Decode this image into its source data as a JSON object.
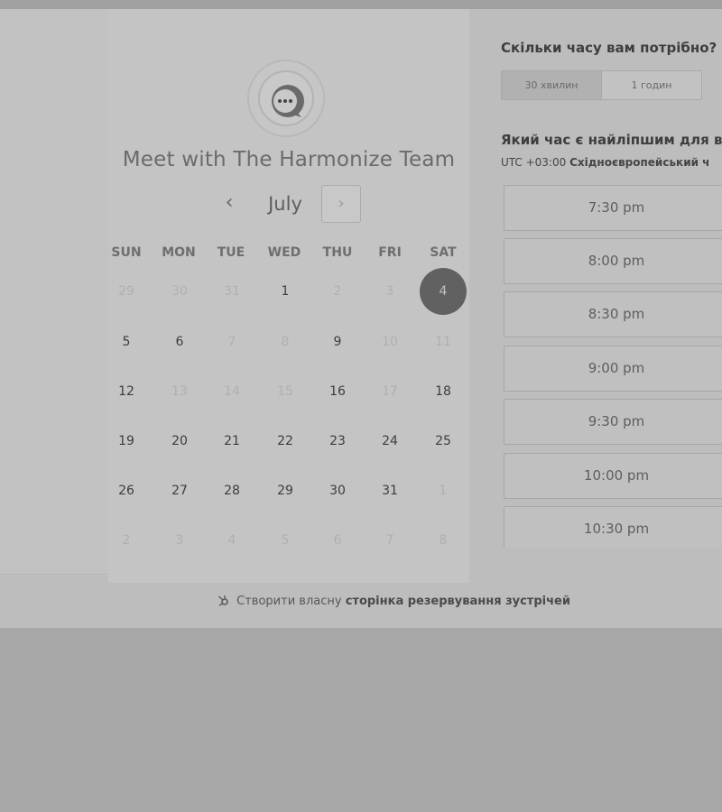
{
  "meeting": {
    "title": "Meet with The Harmonize Team"
  },
  "calendar": {
    "month": "July",
    "prev_glyph": "‹",
    "next_glyph": "›",
    "weekdays": [
      "SUN",
      "MON",
      "TUE",
      "WED",
      "THU",
      "FRI",
      "SAT"
    ],
    "weeks": [
      [
        {
          "d": "29",
          "s": "muted"
        },
        {
          "d": "30",
          "s": "muted"
        },
        {
          "d": "31",
          "s": "muted"
        },
        {
          "d": "1",
          "s": "active"
        },
        {
          "d": "2",
          "s": "muted"
        },
        {
          "d": "3",
          "s": "muted"
        },
        {
          "d": "4",
          "s": "selected"
        }
      ],
      [
        {
          "d": "5",
          "s": "active"
        },
        {
          "d": "6",
          "s": "active"
        },
        {
          "d": "7",
          "s": "muted"
        },
        {
          "d": "8",
          "s": "muted"
        },
        {
          "d": "9",
          "s": "active"
        },
        {
          "d": "10",
          "s": "muted"
        },
        {
          "d": "11",
          "s": "muted"
        }
      ],
      [
        {
          "d": "12",
          "s": "active"
        },
        {
          "d": "13",
          "s": "muted"
        },
        {
          "d": "14",
          "s": "muted"
        },
        {
          "d": "15",
          "s": "muted"
        },
        {
          "d": "16",
          "s": "active"
        },
        {
          "d": "17",
          "s": "muted"
        },
        {
          "d": "18",
          "s": "active"
        }
      ],
      [
        {
          "d": "19",
          "s": "active"
        },
        {
          "d": "20",
          "s": "active"
        },
        {
          "d": "21",
          "s": "active"
        },
        {
          "d": "22",
          "s": "active"
        },
        {
          "d": "23",
          "s": "active"
        },
        {
          "d": "24",
          "s": "active"
        },
        {
          "d": "25",
          "s": "active"
        }
      ],
      [
        {
          "d": "26",
          "s": "active"
        },
        {
          "d": "27",
          "s": "active"
        },
        {
          "d": "28",
          "s": "active"
        },
        {
          "d": "29",
          "s": "active"
        },
        {
          "d": "30",
          "s": "active"
        },
        {
          "d": "31",
          "s": "active"
        },
        {
          "d": "1",
          "s": "muted"
        }
      ],
      [
        {
          "d": "2",
          "s": "muted"
        },
        {
          "d": "3",
          "s": "muted"
        },
        {
          "d": "4",
          "s": "muted"
        },
        {
          "d": "5",
          "s": "muted"
        },
        {
          "d": "6",
          "s": "muted"
        },
        {
          "d": "7",
          "s": "muted"
        },
        {
          "d": "8",
          "s": "muted"
        }
      ]
    ]
  },
  "duration": {
    "question": "Скільки часу вам потрібно?",
    "options": [
      "30 хвилин",
      "1 годин"
    ],
    "selected": "30 хвилин"
  },
  "times": {
    "question": "Який час є найліпшим для вас",
    "timezone_offset": "UTC +03:00",
    "timezone_name": "Східноєвропейський ч",
    "slots": [
      "7:30 pm",
      "8:00 pm",
      "8:30 pm",
      "9:00 pm",
      "9:30 pm",
      "10:00 pm",
      "10:30 pm"
    ]
  },
  "footer": {
    "prefix": "Створити власну",
    "link": "сторінка резервування зустрічей"
  },
  "colors": {
    "selected_day": "#616161",
    "overlay": "#a8a8a8"
  }
}
